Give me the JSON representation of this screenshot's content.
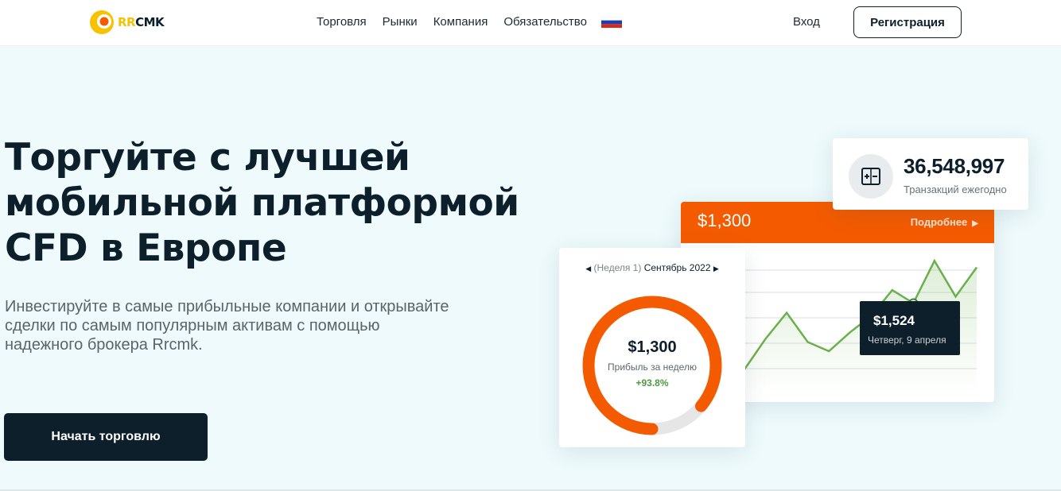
{
  "brand": {
    "logo_rr": "RR",
    "logo_cmk": "CMK",
    "accent": "#f45b00",
    "logo_yellow": "#f7c200",
    "dark": "#0c1f2b"
  },
  "nav": {
    "items": [
      "Торговля",
      "Рынки",
      "Компания",
      "Обязательство"
    ],
    "language_flag": "russia-flag-icon"
  },
  "header": {
    "login": "Вход",
    "register": "Регистрация"
  },
  "hero": {
    "title_lines": [
      "Торгуйте с лучшей",
      "мобильной платформой",
      "CFD в Европе"
    ],
    "subtitle_lines": [
      "Инвестируйте в самые прибыльные компании и открывайте",
      "сделки по самым популярным активам с помощью",
      "надежного брокера Rrcmk."
    ],
    "cta": "Начать торговлю"
  },
  "transactions": {
    "value": "36,548,997",
    "label": "Транзакций ежегодно",
    "icon": "plus-minus-icon"
  },
  "chart_card": {
    "amount": "$1,300",
    "more": "Подробнее",
    "tooltip_value": "$1,524",
    "tooltip_date": "Четверг, 9 апреля",
    "line_color": "#6ab04c"
  },
  "donut_card": {
    "week_prefix": "(Неделя 1)",
    "week_month": "Сентябрь 2022",
    "amount": "$1,300",
    "label": "Прибыль за неделю",
    "change": "+93.8%",
    "progress": 0.86
  },
  "chart_data": {
    "type": "line",
    "title": "",
    "xlabel": "",
    "ylabel": "",
    "y": [
      38,
      85,
      125,
      80,
      66,
      95,
      120,
      160,
      140,
      205,
      150,
      195
    ]
  }
}
